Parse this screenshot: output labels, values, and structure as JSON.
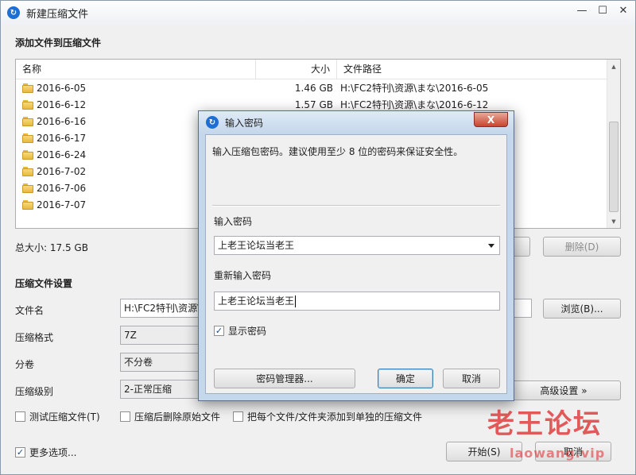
{
  "window": {
    "title": "新建压缩文件",
    "controls": [
      "minimize-icon",
      "maximize-icon",
      "close-icon"
    ]
  },
  "files": {
    "section_title": "添加文件到压缩文件",
    "columns": {
      "name": "名称",
      "size": "大小",
      "path": "文件路径"
    },
    "rows": [
      {
        "name": "2016-6-05",
        "size": "1.46 GB",
        "path": "H:\\FC2特刊\\资源\\まな\\2016-6-05"
      },
      {
        "name": "2016-6-12",
        "size": "1.57 GB",
        "path": "H:\\FC2特刊\\资源\\まな\\2016-6-12"
      },
      {
        "name": "2016-6-16",
        "size": "",
        "path": ""
      },
      {
        "name": "2016-6-17",
        "size": "",
        "path": ""
      },
      {
        "name": "2016-6-24",
        "size": "",
        "path": ""
      },
      {
        "name": "2016-7-02",
        "size": "",
        "path": ""
      },
      {
        "name": "2016-7-06",
        "size": "",
        "path": ""
      },
      {
        "name": "2016-7-07",
        "size": "",
        "path": ""
      }
    ],
    "total_size": "总大小: 17.5 GB",
    "delete_label": "删除(D)"
  },
  "settings": {
    "section_title": "压缩文件设置",
    "filename_label": "文件名",
    "filename_value": "H:\\FC2特刊\\资源\\",
    "browse_label": "浏览(B)...",
    "format_label": "压缩格式",
    "format_value": "7Z",
    "split_label": "分卷",
    "split_value": "不分卷",
    "level_label": "压缩级别",
    "level_value": "2-正常压缩",
    "advanced_label": "高级设置 »",
    "test_label": "测试压缩文件(T)",
    "delete_after_label": "压缩后删除原始文件",
    "each_label": "把每个文件/文件夹添加到单独的压缩文件",
    "more_label": "更多选项...",
    "start_label": "开始(S)",
    "cancel_label": "取消"
  },
  "password_dialog": {
    "title": "输入密码",
    "hint": "输入压缩包密码。建议使用至少 8 位的密码来保证安全性。",
    "password_label": "输入密码",
    "password_value": "上老王论坛当老王",
    "confirm_label": "重新输入密码",
    "confirm_value": "上老王论坛当老王",
    "show_password_label": "显示密码",
    "show_password_checked": true,
    "manager_label": "密码管理器...",
    "ok_label": "确定",
    "cancel_label": "取消",
    "close_label": "X"
  },
  "watermark": {
    "text": "老王论坛",
    "url": "laowang.vip"
  }
}
